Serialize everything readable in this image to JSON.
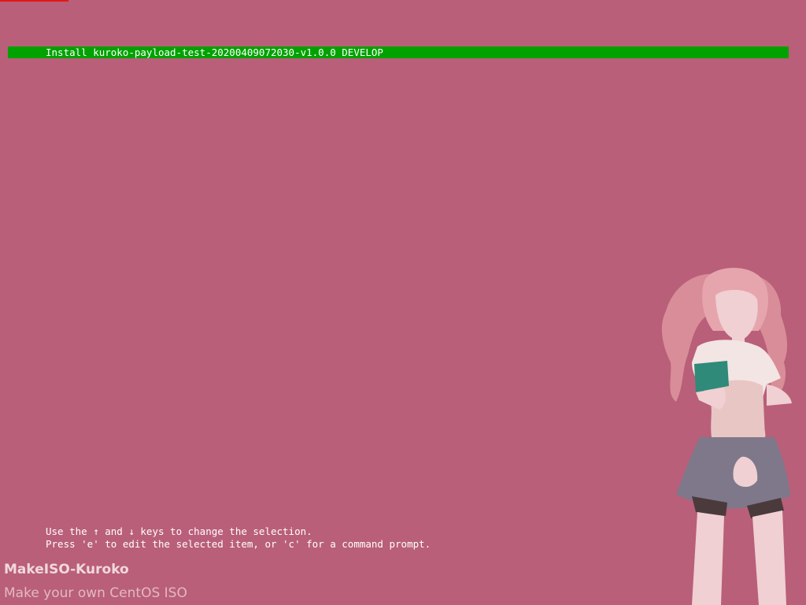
{
  "menu": {
    "entries": [
      {
        "label": "Install kuroko-payload-test-20200409072030-v1.0.0 DEVELOP",
        "selected": true
      }
    ]
  },
  "help": {
    "line1": "Use the ↑ and ↓ keys to change the selection.",
    "line2": "Press 'e' to edit the selected item, or 'c' for a command prompt."
  },
  "branding": {
    "title": "MakeISO-Kuroko",
    "subtitle": "Make your own CentOS ISO"
  },
  "colors": {
    "background": "#b95f79",
    "selection": "#00a200",
    "top_bar": "#e31818"
  },
  "illustration": {
    "subject": "anime-girl-figure"
  }
}
